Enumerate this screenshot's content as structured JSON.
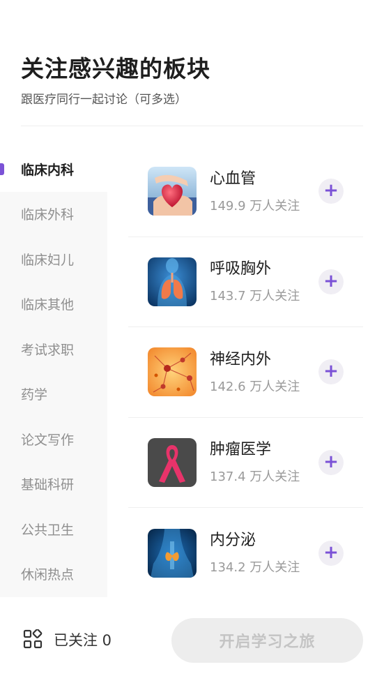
{
  "header": {
    "title": "关注感兴趣的板块",
    "subtitle": "跟医疗同行一起讨论（可多选）"
  },
  "sidebar": {
    "items": [
      {
        "label": "临床内科",
        "active": true
      },
      {
        "label": "临床外科"
      },
      {
        "label": "临床妇儿"
      },
      {
        "label": "临床其他"
      },
      {
        "label": "考试求职"
      },
      {
        "label": "药学"
      },
      {
        "label": "论文写作"
      },
      {
        "label": "基础科研"
      },
      {
        "label": "公共卫生"
      },
      {
        "label": "休闲热点"
      }
    ]
  },
  "topics": [
    {
      "name": "心血管",
      "followers": "149.9 万人关注",
      "icon": "heart-image"
    },
    {
      "name": "呼吸胸外",
      "followers": "143.7 万人关注",
      "icon": "lungs-image"
    },
    {
      "name": "神经内外",
      "followers": "142.6 万人关注",
      "icon": "neurons-image"
    },
    {
      "name": "肿瘤医学",
      "followers": "137.4 万人关注",
      "icon": "pink-ribbon-image"
    },
    {
      "name": "内分泌",
      "followers": "134.2 万人关注",
      "icon": "thyroid-image"
    }
  ],
  "footer": {
    "followed_label": "已关注 0",
    "start_button": "开启学习之旅"
  },
  "colors": {
    "accent": "#7b52d6",
    "sidebar_bg": "#f8f8f8",
    "button_disabled_bg": "#ededed"
  }
}
